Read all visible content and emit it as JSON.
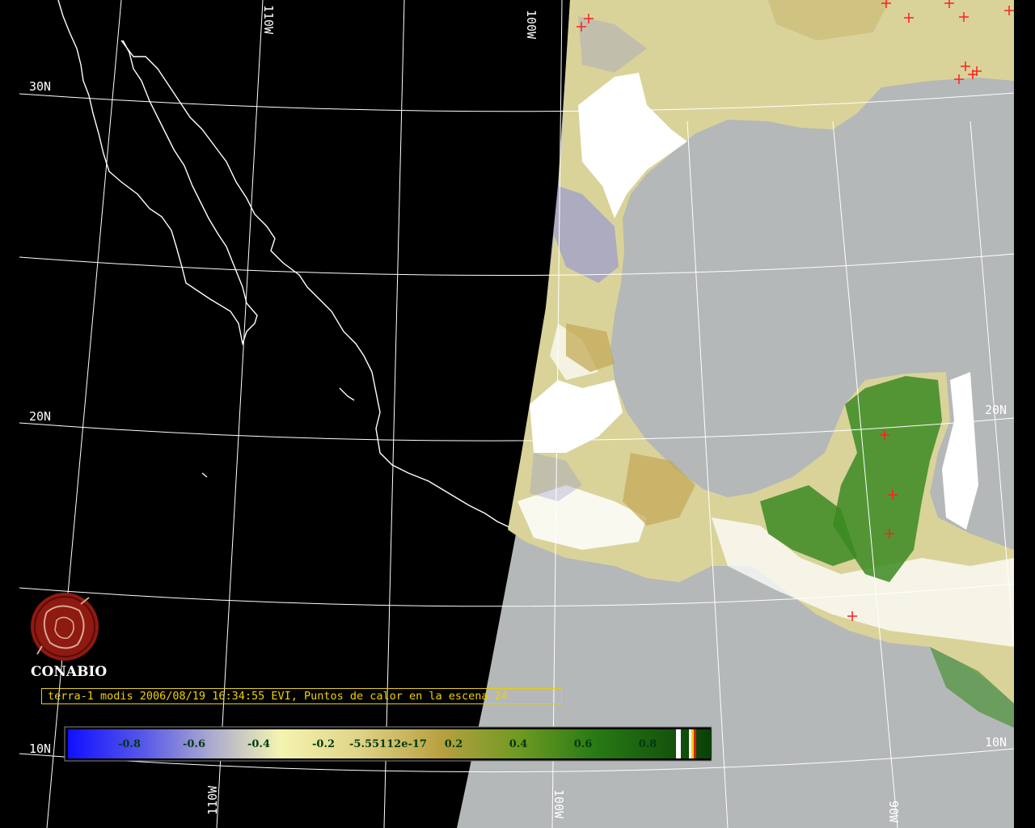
{
  "caption": "terra-1 modis 2006/08/19 16:34:55 EVI, Puntos de calor en la escena 24",
  "logo": {
    "text": "CONABIO",
    "icon": "conabio-seal-icon"
  },
  "grid_labels": {
    "lon_110_top": "110W",
    "lon_100_top": "100W",
    "lon_110_bottom": "110W",
    "lon_100_bottom": "100W",
    "lon_90_bottom": "90W",
    "lat_30": "30N",
    "lat_20_left": "20N",
    "lat_20_right": "20N",
    "lat_10_left": "10N",
    "lat_10_right": "10N"
  },
  "colorbar": {
    "ticks": [
      "-0.8",
      "-0.6",
      "-0.4",
      "-0.2",
      "-5.55112e-17",
      "0.2",
      "0.4",
      "0.6",
      "0.8"
    ],
    "gradient_colors": [
      "#1010ff",
      "#8888d8",
      "#f0f0b0",
      "#d8c870",
      "#b8a040",
      "#6a9a20",
      "#1a7010",
      "#0a3a08"
    ]
  },
  "colors": {
    "background": "#000000",
    "ocean": "#b4b8b9",
    "cloud": "#ffffff",
    "vegetation_low": "#d8d090",
    "vegetation_high": "#2f7a1a",
    "hotspot": "#ff2020",
    "grid": "#ffffff",
    "caption": "#f0d000"
  },
  "legend_meaning": {
    "hotspot_marker": "red cross"
  }
}
